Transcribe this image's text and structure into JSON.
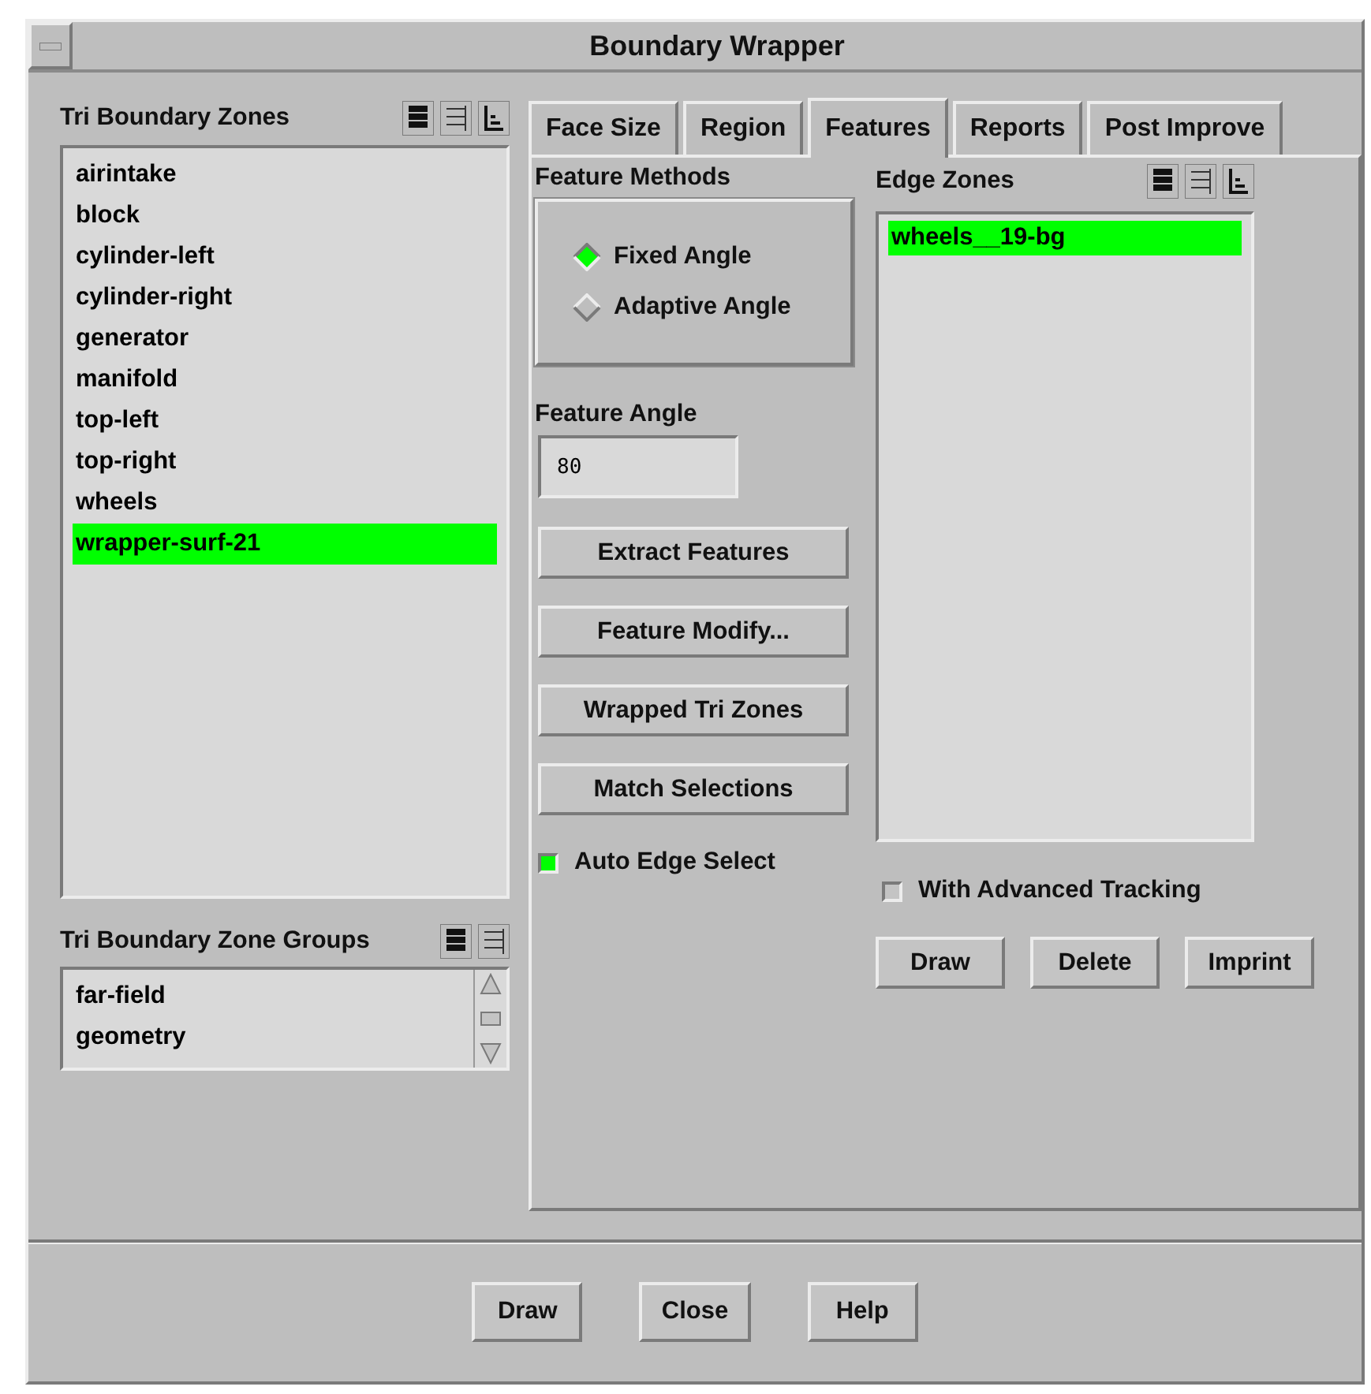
{
  "window": {
    "title": "Boundary Wrapper"
  },
  "zones": {
    "label": "Tri Boundary Zones",
    "items": [
      {
        "text": "airintake",
        "selected": false
      },
      {
        "text": "block",
        "selected": false
      },
      {
        "text": "cylinder-left",
        "selected": false
      },
      {
        "text": "cylinder-right",
        "selected": false
      },
      {
        "text": "generator",
        "selected": false
      },
      {
        "text": "manifold",
        "selected": false
      },
      {
        "text": "top-left",
        "selected": false
      },
      {
        "text": "top-right",
        "selected": false
      },
      {
        "text": "wheels",
        "selected": false
      },
      {
        "text": "wrapper-surf-21",
        "selected": true
      }
    ]
  },
  "groups": {
    "label": "Tri Boundary Zone Groups",
    "items": [
      {
        "text": "far-field",
        "selected": false
      },
      {
        "text": "geometry",
        "selected": false
      }
    ]
  },
  "tabs": [
    {
      "label": "Face Size",
      "selected": false
    },
    {
      "label": "Region",
      "selected": false
    },
    {
      "label": "Features",
      "selected": true
    },
    {
      "label": "Reports",
      "selected": false
    },
    {
      "label": "Post Improve",
      "selected": false
    }
  ],
  "feature_methods": {
    "label": "Feature Methods",
    "options": [
      {
        "label": "Fixed Angle",
        "selected": true
      },
      {
        "label": "Adaptive Angle",
        "selected": false
      }
    ]
  },
  "feature_angle": {
    "label": "Feature Angle",
    "value": "80"
  },
  "action_buttons": [
    "Extract Features",
    "Feature Modify...",
    "Wrapped Tri Zones",
    "Match Selections"
  ],
  "auto_edge_select": {
    "label": "Auto Edge Select",
    "checked": true
  },
  "edge_zones": {
    "label": "Edge Zones",
    "items": [
      {
        "text": "wheels__19-bg",
        "selected": true
      }
    ]
  },
  "advanced_tracking": {
    "label": "With Advanced Tracking",
    "checked": false
  },
  "edge_buttons": [
    "Draw",
    "Delete",
    "Imprint"
  ],
  "footer_buttons": [
    "Draw",
    "Close",
    "Help"
  ]
}
